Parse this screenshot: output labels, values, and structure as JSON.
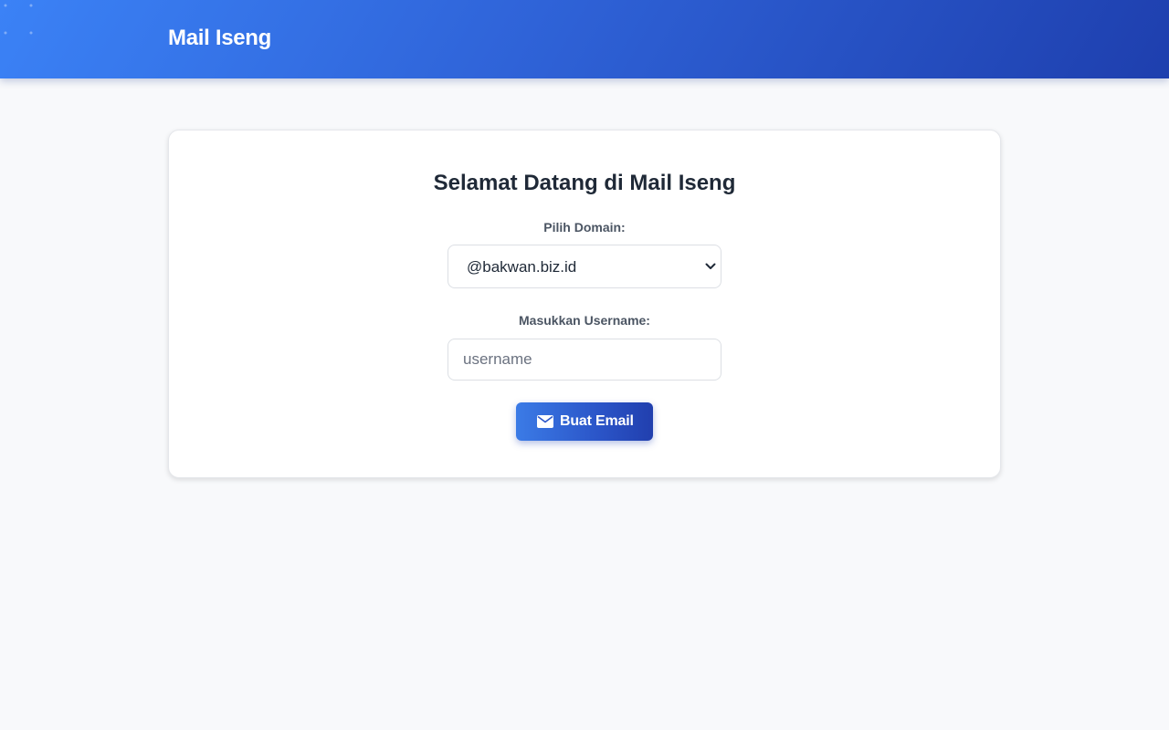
{
  "header": {
    "brand": "Mail Iseng"
  },
  "card": {
    "title": "Selamat Datang di Mail Iseng",
    "domain_label": "Pilih Domain:",
    "domain_selected": "@bakwan.biz.id",
    "username_label": "Masukkan Username:",
    "username_value": "",
    "username_placeholder": "username",
    "submit_label": "Buat Email"
  },
  "icons": {
    "submit": "envelope-icon",
    "select": "chevron-down-icon"
  },
  "colors": {
    "accent_start": "#3b82f6",
    "accent_end": "#1e3fae",
    "page_bg": "#f8f9fb",
    "card_bg": "#ffffff"
  }
}
